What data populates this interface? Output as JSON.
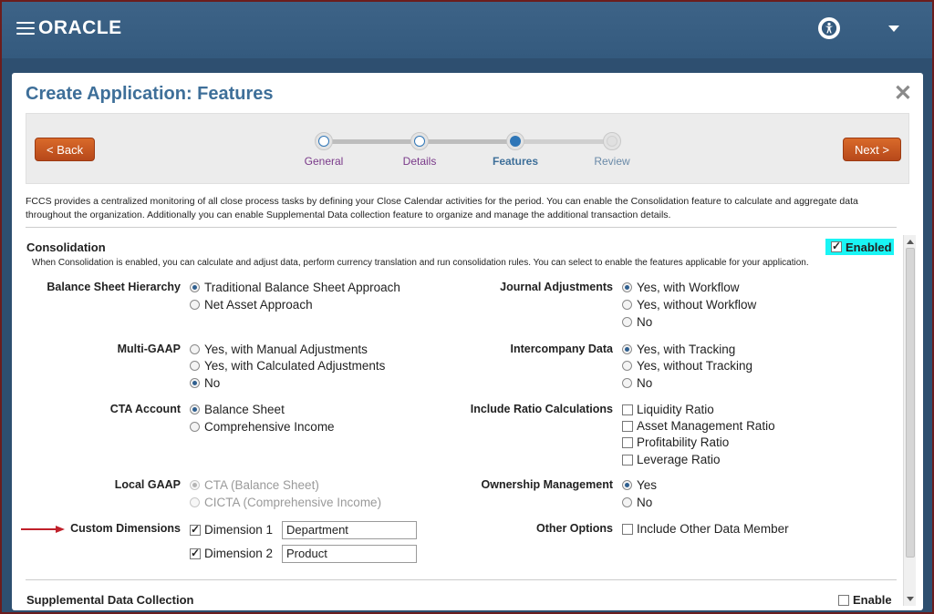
{
  "header": {
    "logo": "ORACLE",
    "menu_icon": "hamburger-icon",
    "accessibility_icon": "accessibility-icon",
    "user_menu_icon": "caret-down-icon"
  },
  "dialog": {
    "title": "Create Application:  Features",
    "close_icon": "close-icon",
    "back_label": "< Back",
    "next_label": "Next >",
    "train": [
      {
        "label": "General",
        "state": "visited"
      },
      {
        "label": "Details",
        "state": "visited"
      },
      {
        "label": "Features",
        "state": "current"
      },
      {
        "label": "Review",
        "state": "pending"
      }
    ],
    "description": "FCCS provides a centralized monitoring of all close process tasks by defining your Close Calendar activities for the period. You can enable the Consolidation feature to calculate and aggregate data throughout the organization. Additionally you can enable Supplemental Data collection feature to organize and manage the additional transaction details."
  },
  "consolidation": {
    "title": "Consolidation",
    "subtitle": "When Consolidation is enabled, you can calculate and adjust data, perform currency translation and run consolidation rules. You can select to enable the features applicable for your application.",
    "enabled_label": "Enabled",
    "enabled": true,
    "balance_sheet_hierarchy": {
      "label": "Balance Sheet Hierarchy",
      "options": [
        "Traditional Balance Sheet Approach",
        "Net Asset Approach"
      ],
      "selected": 0
    },
    "multi_gaap": {
      "label": "Multi-GAAP",
      "options": [
        "Yes, with Manual Adjustments",
        "Yes, with Calculated Adjustments",
        "No"
      ],
      "selected": 2
    },
    "cta_account": {
      "label": "CTA Account",
      "options": [
        "Balance Sheet",
        "Comprehensive Income"
      ],
      "selected": 0
    },
    "local_gaap": {
      "label": "Local GAAP",
      "options": [
        "CTA (Balance Sheet)",
        "CICTA (Comprehensive Income)"
      ],
      "selected": 0,
      "disabled": true
    },
    "custom_dimensions": {
      "label": "Custom Dimensions",
      "items": [
        {
          "label": "Dimension 1",
          "value": "Department",
          "checked": true
        },
        {
          "label": "Dimension 2",
          "value": "Product",
          "checked": true
        }
      ]
    },
    "journal_adjustments": {
      "label": "Journal Adjustments",
      "options": [
        "Yes, with Workflow",
        "Yes, without Workflow",
        "No"
      ],
      "selected": 0
    },
    "intercompany_data": {
      "label": "Intercompany Data",
      "options": [
        "Yes, with Tracking",
        "Yes, without Tracking",
        "No"
      ],
      "selected": 0
    },
    "ratio_calculations": {
      "label": "Include Ratio Calculations",
      "options": [
        "Liquidity Ratio",
        "Asset Management Ratio",
        "Profitability Ratio",
        "Leverage Ratio"
      ]
    },
    "ownership_management": {
      "label": "Ownership Management",
      "options": [
        "Yes",
        "No"
      ],
      "selected": 0
    },
    "other_options": {
      "label": "Other Options",
      "option": "Include Other Data Member"
    }
  },
  "supplemental": {
    "title": "Supplemental Data Collection",
    "enable_label": "Enable"
  },
  "colors": {
    "topbar": "#3d6387",
    "title": "#3e6f99",
    "button": "#c5531f",
    "highlight": "#19f5f5",
    "arrow": "#c0202a"
  }
}
